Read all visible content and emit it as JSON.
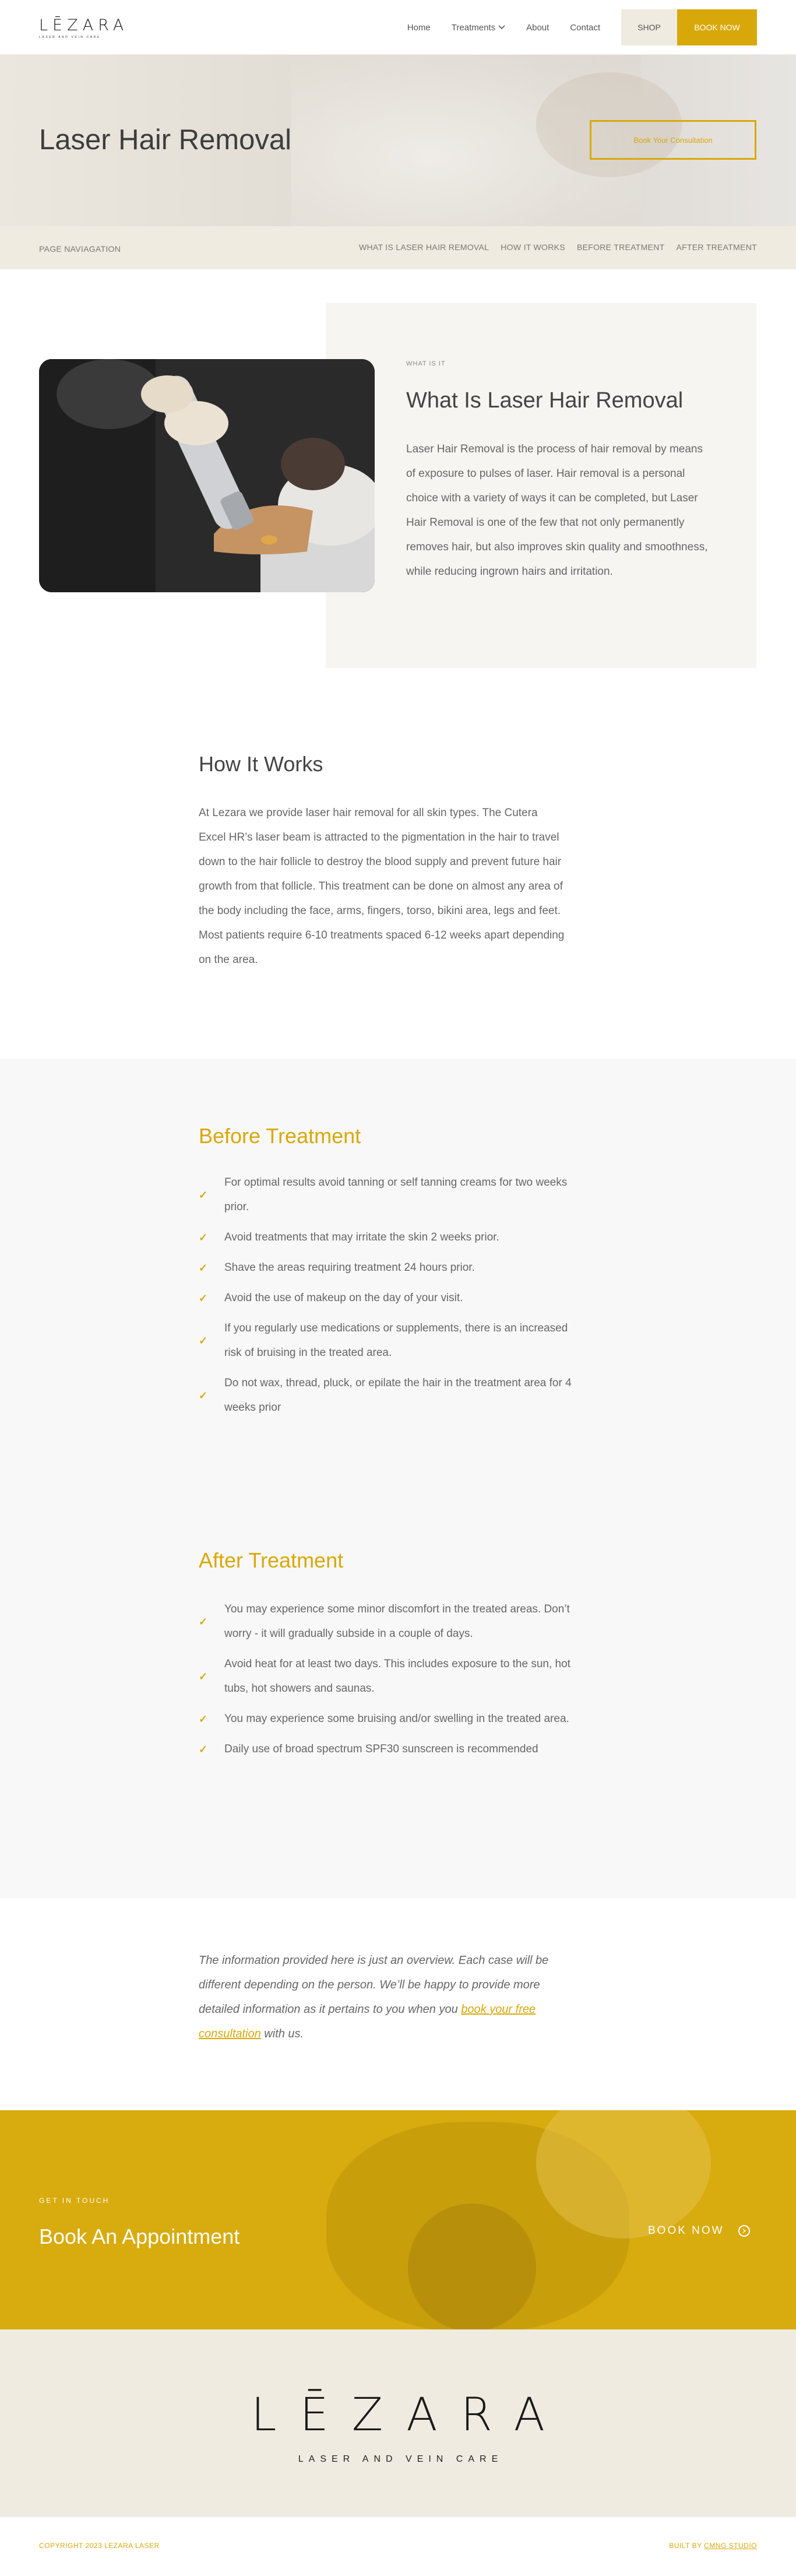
{
  "brand": {
    "logo_text": "LĒZARA",
    "logo_tagline": "LASER AND VEIN CARE",
    "accent_color": "#d8a80a"
  },
  "nav": {
    "items": [
      "Home",
      "Treatments",
      "About",
      "Contact"
    ],
    "treatments_chevron": "chevron-down-icon",
    "shop_label": "SHOP",
    "book_label": "BOOK NOW"
  },
  "hero": {
    "title": "Laser Hair Removal",
    "consult_label": "Book Your Consultation"
  },
  "page_nav": {
    "label": "PAGE NAVIAGATION",
    "links": [
      "WHAT IS LASER HAIR REMOVAL",
      "HOW IT WORKS",
      "BEFORE TREATMENT",
      "AFTER TREATMENT"
    ]
  },
  "what": {
    "eyebrow": "WHAT IS IT",
    "title": "What Is Laser Hair Removal",
    "body": "Laser Hair Removal is the process of hair removal by means of exposure to pulses of laser. Hair removal is a personal choice with a variety of ways it can be completed, but Laser Hair Removal is one of the few that not only permanently removes hair, but also improves skin quality and smoothness, while reducing ingrown hairs and irritation."
  },
  "how": {
    "title": "How It Works",
    "body": "At Lezara we provide laser hair removal for all skin types. The Cutera Excel HR’s laser beam is attracted to the pigmentation in the hair to travel down to the hair follicle to destroy the blood supply and prevent future hair growth from that follicle. This treatment can be done on almost any area of the body including the face, arms, fingers, torso, bikini area, legs and feet. Most patients require 6-10 treatments spaced 6-12 weeks apart depending on the area."
  },
  "before": {
    "title": "Before Treatment",
    "items": [
      "For optimal results avoid tanning or self tanning creams for two weeks prior.",
      "Avoid treatments that may irritate the skin 2 weeks prior.",
      "Shave the areas requiring treatment 24 hours prior.",
      "Avoid the use of makeup on the day of your visit.",
      "If you regularly use medications or supplements, there is an increased risk of bruising in the treated area.",
      "Do not wax, thread, pluck, or epilate the hair in the treatment area for 4 weeks prior"
    ]
  },
  "after": {
    "title": "After Treatment",
    "items": [
      "You may experience some minor discomfort in the treated areas. Don’t worry - it will gradually subside in a couple of days.",
      "Avoid heat for at least two days. This includes exposure to the sun, hot tubs, hot showers and saunas.",
      "You may experience some bruising and/or swelling in the treated area.",
      "Daily use of broad spectrum SPF30 sunscreen is recommended"
    ]
  },
  "note": {
    "before_link": "The information provided here is just an overview. Each case will be different depending on the person. We’ll be happy to provide more detailed information as it pertains to you when you ",
    "link_text": "book your free consultation",
    "after_link": " with us."
  },
  "cta": {
    "eyebrow": "GET IN TOUCH",
    "title": "Book An Appointment",
    "button": "BOOK NOW"
  },
  "footer": {
    "logo_text": "LĒZARA",
    "tagline": "LASER AND VEIN CARE",
    "copyright": "COPYRIGHT 2023 LEZARA LASER",
    "built_by_prefix": "BUILT BY ",
    "built_by_link": "CMNG STUDIO"
  }
}
